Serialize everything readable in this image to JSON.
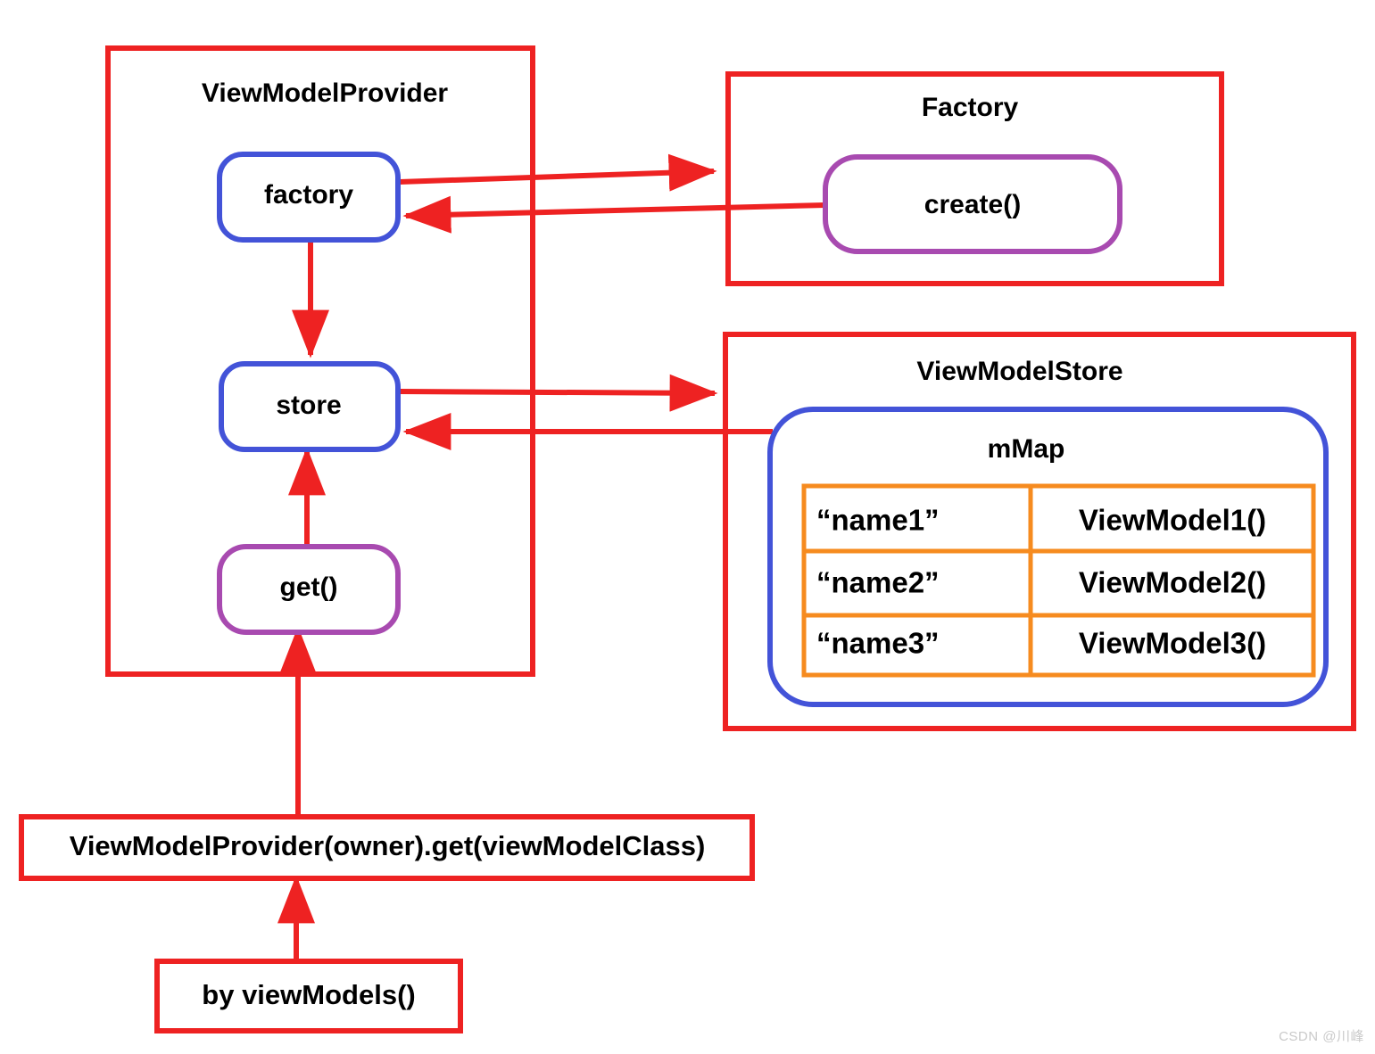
{
  "diagram": {
    "title": "ViewModelProvider architecture",
    "colors": {
      "red": "#ee2222",
      "blue": "#4353d8",
      "purple": "#a84ab0",
      "orange": "#f68b1f",
      "text": "#000000",
      "background": "#ffffff"
    },
    "groups": {
      "provider": {
        "label": "ViewModelProvider"
      },
      "factory": {
        "label": "Factory"
      },
      "store": {
        "label": "ViewModelStore"
      }
    },
    "nodes": {
      "factory_field": {
        "label": "factory"
      },
      "store_field": {
        "label": "store"
      },
      "get_method": {
        "label": "get()"
      },
      "create_method": {
        "label": "create()"
      },
      "mmap": {
        "label": "mMap"
      }
    },
    "mmap_table": {
      "rows": [
        {
          "key": "“name1”",
          "value": "ViewModel1()"
        },
        {
          "key": "“name2”",
          "value": "ViewModel2()"
        },
        {
          "key": "“name3”",
          "value": "ViewModel3()"
        }
      ]
    },
    "callers": {
      "provider_call": {
        "label": "ViewModelProvider(owner).get(viewModelClass)"
      },
      "delegate_call": {
        "label": "by viewModels()"
      }
    },
    "watermark": {
      "label": "CSDN @川峰"
    }
  }
}
